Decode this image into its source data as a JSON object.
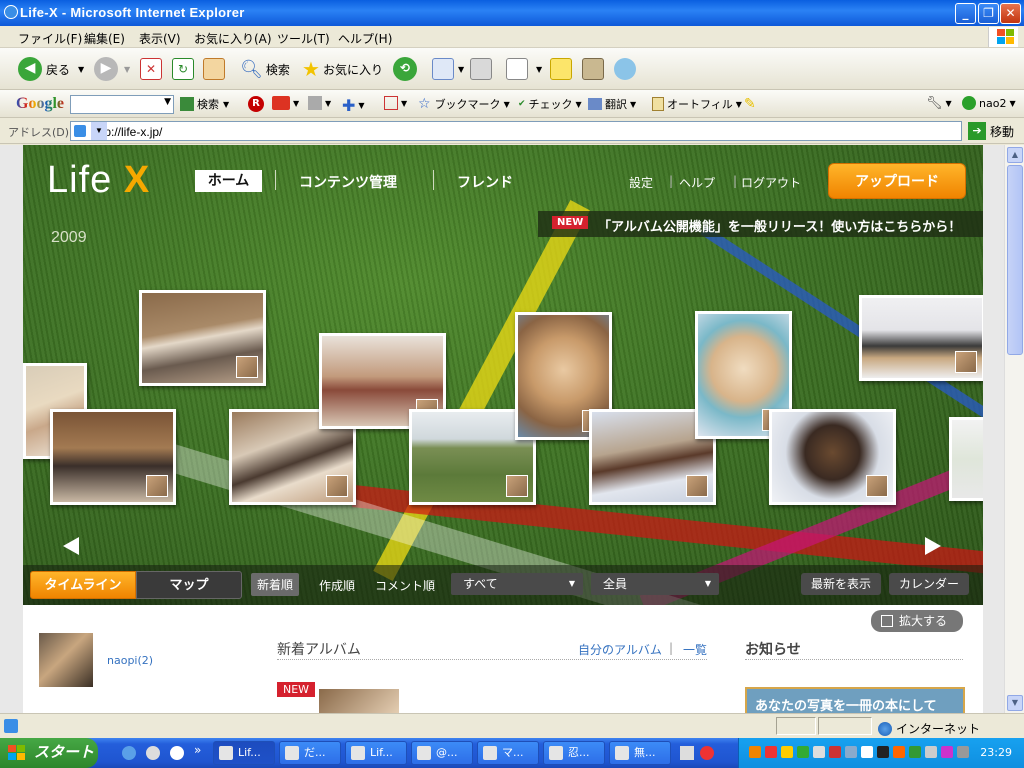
{
  "window": {
    "title": "Life-X - Microsoft Internet Explorer"
  },
  "menu": [
    "ファイル(F)",
    "編集(E)",
    "表示(V)",
    "お気に入り(A)",
    "ツール(T)",
    "ヘルプ(H)"
  ],
  "toolbar": {
    "back": "戻る",
    "search": "検索",
    "favorites": "お気に入り"
  },
  "googlebar": {
    "logo": "Google",
    "search": "検索",
    "bookmark": "ブックマーク",
    "check": "チェック",
    "translate": "翻訳",
    "autofill": "オートフィル",
    "user": "nao2"
  },
  "address": {
    "label": "アドレス(D)",
    "url": "http://life-x.jp/",
    "go": "移動"
  },
  "site": {
    "logo_text": "Life",
    "logo_x": "X",
    "nav": {
      "home": "ホーム",
      "contents": "コンテンツ管理",
      "friends": "フレンド"
    },
    "header_links": {
      "settings": "設定",
      "help": "ヘルプ",
      "logout": "ログアウト"
    },
    "upload": "アップロード",
    "news_badge": "NEW",
    "news_text": "「アルバム公開機能」を一般リリース！使い方はこちらから！",
    "year": "2009",
    "controls": {
      "timeline": "タイムライン",
      "map": "マップ",
      "sort_new": "新着順",
      "sort_created": "作成順",
      "sort_comment": "コメント順",
      "filter_all": "すべて",
      "filter_members": "全員",
      "show_latest": "最新を表示",
      "calendar": "カレンダー"
    },
    "zoom": "拡大する",
    "user_name": "naopi(2)",
    "new_albums": "新着アルバム",
    "my_albums": "自分のアルバム",
    "list": "一覧",
    "news": "お知らせ",
    "new_badge": "NEW",
    "banner": "あなたの写真を一冊の本にして"
  },
  "status": {
    "zone": "インターネット"
  },
  "taskbar": {
    "start": "スタート",
    "tasks": [
      "Lif...",
      "だ...",
      "Lif...",
      "@...",
      "マ...",
      "忍...",
      "無..."
    ],
    "clock": "23:29"
  },
  "colors": {
    "accent_orange": "#f08400",
    "news_red": "#d5212e",
    "grass": "#3b6f22"
  }
}
